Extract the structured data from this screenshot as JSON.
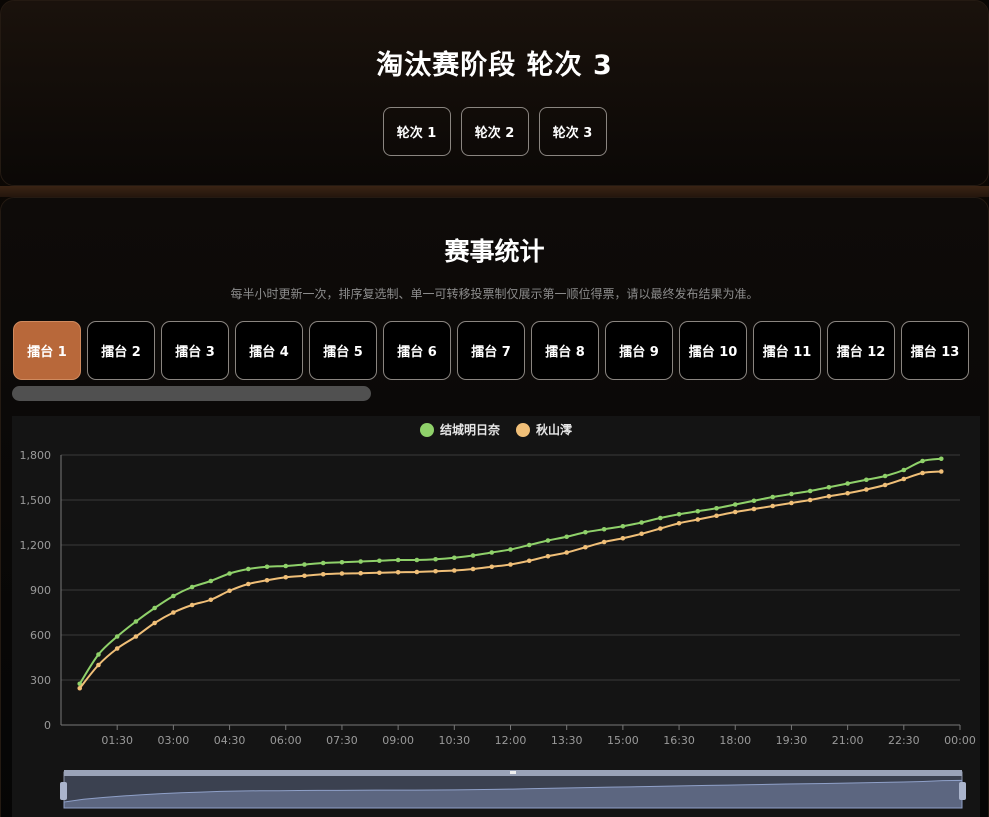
{
  "top": {
    "title": "淘汰赛阶段 轮次 3",
    "rounds": [
      "轮次 1",
      "轮次 2",
      "轮次 3"
    ]
  },
  "stats": {
    "title": "赛事统计",
    "note": "每半小时更新一次，排序复选制、单一可转移投票制仅展示第一顺位得票，请以最终发布结果为准。",
    "stages": [
      "擂台 1",
      "擂台 2",
      "擂台 3",
      "擂台 4",
      "擂台 5",
      "擂台 6",
      "擂台 7",
      "擂台 8",
      "擂台 9",
      "擂台 10",
      "擂台 11",
      "擂台 12",
      "擂台 13"
    ],
    "active_stage": 0
  },
  "colors": {
    "series1": "#8fd16a",
    "series2": "#f0bf78",
    "accent": "#b8683a"
  },
  "chart_data": {
    "type": "line",
    "x_ticks": [
      "01:30",
      "03:00",
      "04:30",
      "06:00",
      "07:30",
      "09:00",
      "10:30",
      "12:00",
      "13:30",
      "15:00",
      "16:30",
      "18:00",
      "19:30",
      "21:00",
      "22:30",
      "00:00"
    ],
    "y_ticks": [
      "0",
      "300",
      "600",
      "900",
      "1,200",
      "1,500",
      "1,800"
    ],
    "ylim": [
      0,
      1800
    ],
    "x_range_hours": [
      0.5,
      24
    ],
    "x_step_hours": 0.5,
    "series": [
      {
        "name": "结城明日奈",
        "values": [
          275,
          470,
          590,
          690,
          780,
          860,
          920,
          960,
          1010,
          1040,
          1055,
          1060,
          1070,
          1080,
          1085,
          1090,
          1095,
          1100,
          1100,
          1105,
          1115,
          1130,
          1150,
          1170,
          1200,
          1230,
          1255,
          1285,
          1305,
          1325,
          1350,
          1380,
          1405,
          1425,
          1445,
          1470,
          1495,
          1520,
          1540,
          1560,
          1585,
          1610,
          1635,
          1660,
          1700,
          1760,
          1775
        ]
      },
      {
        "name": "秋山澪",
        "values": [
          245,
          400,
          510,
          590,
          680,
          750,
          800,
          835,
          895,
          940,
          965,
          985,
          995,
          1005,
          1010,
          1012,
          1015,
          1018,
          1020,
          1025,
          1030,
          1040,
          1055,
          1070,
          1095,
          1125,
          1150,
          1185,
          1220,
          1245,
          1275,
          1310,
          1345,
          1370,
          1395,
          1420,
          1440,
          1460,
          1480,
          1500,
          1525,
          1545,
          1570,
          1600,
          1640,
          1680,
          1690
        ]
      }
    ]
  }
}
